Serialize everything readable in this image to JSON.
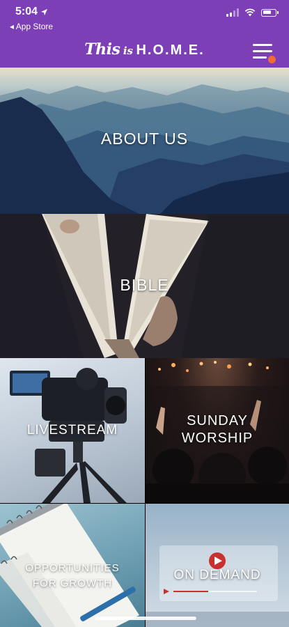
{
  "status_bar": {
    "time": "5:04",
    "back_label": "◂ App Store"
  },
  "header": {
    "logo_script": "This",
    "logo_is": "is",
    "logo_home": "H.O.M.E.",
    "menu_icon": "hamburger-menu-icon",
    "notification_dot_color": "#f06a3a"
  },
  "colors": {
    "brand_purple": "#7d3fb6"
  },
  "tiles": [
    {
      "label": "ABOUT US",
      "image": "mountain-landscape"
    },
    {
      "label": "BIBLE",
      "image": "open-book"
    },
    {
      "label": "LIVESTREAM",
      "image": "video-camera"
    },
    {
      "label_line1": "SUNDAY",
      "label_line2": "WORSHIP",
      "image": "worship-crowd"
    },
    {
      "label_line1": "OPPORTUNITIES",
      "label_line2": "FOR GROWTH",
      "image": "notebook"
    },
    {
      "label": "ON DEMAND",
      "image": "video-player"
    }
  ]
}
